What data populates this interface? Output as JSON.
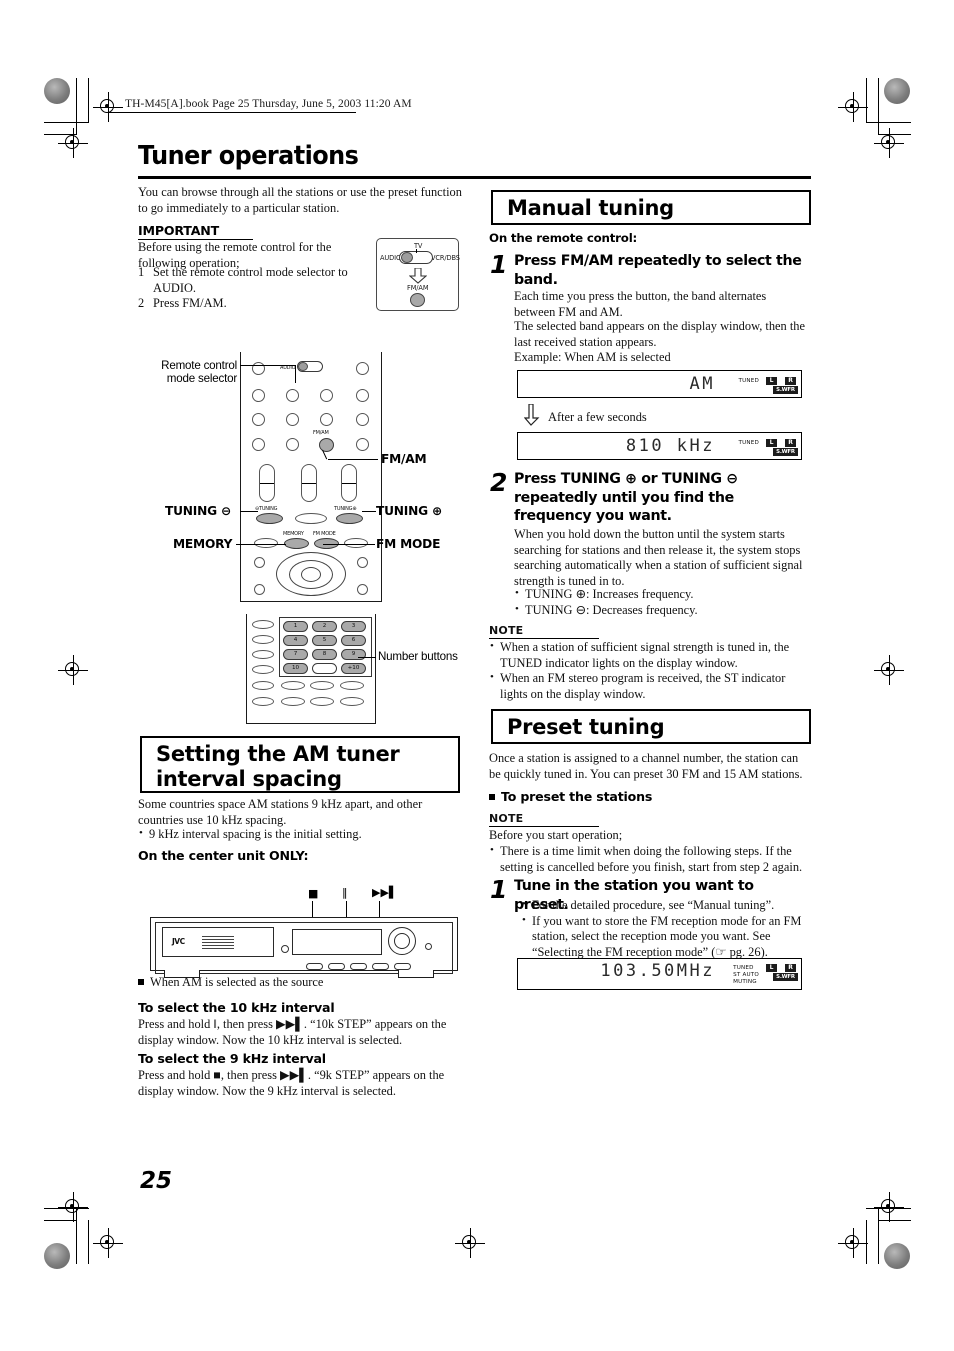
{
  "meta": {
    "slug": "TH-M45[A].book  Page 25  Thursday, June 5, 2003  11:20 AM",
    "page_number": "25"
  },
  "title": "Tuner operations",
  "intro": "You can browse through all the stations or use the preset function to go immediately to a particular station.",
  "important": {
    "label": "IMPORTANT",
    "lead": "Before using the remote control for the following operation;",
    "steps": [
      "Set the remote control mode selector to AUDIO.",
      "Press FM/AM."
    ]
  },
  "selector_illustration": {
    "top_label": "TV",
    "left_label": "AUDIO",
    "right_label": "VCR/DBS",
    "bottom_label": "FM/AM"
  },
  "remote_callouts": {
    "mode_selector": "Remote control\nmode selector",
    "fm_am": "FM/AM",
    "tuning_minus": "TUNING ⊖",
    "tuning_plus": "TUNING ⊕",
    "memory": "MEMORY",
    "fm_mode": "FM MODE",
    "number_buttons": "Number buttons"
  },
  "remote_keys": {
    "audio": "AUDIO",
    "fm_am": "FM/AM",
    "tuning_minus": "⊖TUNING",
    "tuning_plus": "TUNING⊕",
    "memory": "MEMORY",
    "fm_mode": "FM MODE",
    "numbers": [
      "1",
      "2",
      "3",
      "4",
      "5",
      "6",
      "7",
      "8",
      "9",
      "10",
      "",
      "+10"
    ]
  },
  "am_interval": {
    "heading": "Setting the AM tuner\ninterval spacing",
    "body": "Some countries space AM stations 9 kHz apart, and other countries use 10 kHz spacing.",
    "bullets": [
      "9 kHz interval spacing is the initial setting."
    ],
    "center_unit_only": "On the center unit ONLY:",
    "unit_brand": "JVC",
    "unit_button_glyphs": [
      "■",
      "‖",
      "▶▶▌"
    ],
    "source_note": "When AM is selected as the source",
    "sub_10k": {
      "heading": "To select the 10 kHz interval",
      "body": "Press and hold ‖, then press ▶▶▌. “10k STEP” appears on the display window. Now the 10 kHz interval is selected."
    },
    "sub_9k": {
      "heading": "To select the 9 kHz interval",
      "body": "Press and hold ■, then press ▶▶▌. “9k STEP” appears on the display window. Now the 9 kHz interval is selected."
    }
  },
  "manual_tuning": {
    "heading": "Manual tuning",
    "on_remote": "On the remote control:",
    "step1": {
      "num": "1",
      "head": "Press FM/AM repeatedly to select the band.",
      "body1": "Each time you press the button, the band alternates between FM and AM.",
      "body2": "The selected band appears on the display window, then the last received station appears.",
      "example": "Example: When AM is selected"
    },
    "display_band": {
      "main": "AM",
      "indicators": "TUNED",
      "left": "L",
      "right": "R",
      "subwoofer": "S.WFR"
    },
    "after_label": "After a few seconds",
    "display_freq": {
      "main": "810 kHz",
      "indicators": "TUNED",
      "left": "L",
      "right": "R",
      "subwoofer": "S.WFR"
    },
    "step2": {
      "num": "2",
      "head": "Press TUNING ⊕ or TUNING ⊖ repeatedly until you find the frequency you want.",
      "body": "When you hold down the button until the system starts searching for stations and then release it, the system stops searching automatically when a station of sufficient signal strength is tuned in to.",
      "bullets": [
        "TUNING ⊕:  Increases frequency.",
        "TUNING ⊖:  Decreases frequency."
      ]
    },
    "note": {
      "label": "NOTE",
      "bullets": [
        "When a station of sufficient signal strength is tuned in, the TUNED indicator lights on the display window.",
        "When an FM stereo program is received, the ST indicator lights on the display window."
      ]
    }
  },
  "preset_tuning": {
    "heading": "Preset tuning",
    "body": "Once a station is assigned to a channel number, the station can be quickly tuned in. You can preset 30 FM and 15 AM stations.",
    "subheading": "To preset the stations",
    "note": {
      "label": "NOTE",
      "lead": "Before you start operation;",
      "bullets": [
        "There is a time limit when doing the following steps. If the setting is cancelled before you finish, start from step 2 again."
      ]
    },
    "step1": {
      "num": "1",
      "head": "Tune in the station you want to preset.",
      "bullets": [
        "For the detailed procedure, see “Manual tuning”.",
        "If you want to store the FM reception mode for an FM station, select the reception mode you want. See “Selecting the FM reception mode” (☞ pg. 26)."
      ]
    },
    "display_freq": {
      "main": "103.50MHz",
      "indicators": "TUNED\nST AUTO\nMUTING",
      "left": "L",
      "right": "R",
      "subwoofer": "S.WFR"
    }
  }
}
